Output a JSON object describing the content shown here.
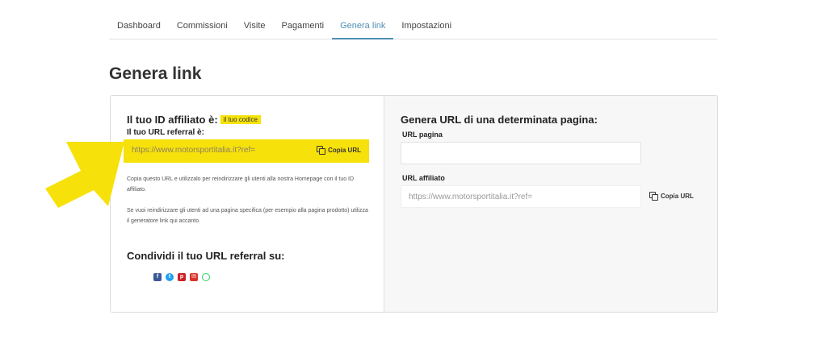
{
  "tabs": [
    {
      "label": "Dashboard"
    },
    {
      "label": "Commissioni"
    },
    {
      "label": "Visite"
    },
    {
      "label": "Pagamenti"
    },
    {
      "label": "Genera link",
      "active": true
    },
    {
      "label": "Impostazioni"
    }
  ],
  "page": {
    "title": "Genera link"
  },
  "left": {
    "id_title": "Il tuo ID affiliato è:",
    "id_code": "il tuo codice",
    "ref_label": "Il tuo URL referral è:",
    "ref_url": "https://www.motorsportitalia.it?ref=",
    "copy_label": "Copia URL",
    "help1": "Copia questo URL e utilizzalo per reindirizzare gli utenti alla nostra Homepage con il tuo ID affiliato.",
    "help2": "Se vuoi reindirizzare gli utenti ad una pagina specifica (per esempio alla pagina prodotto) utilizza il generatore link qui accanto.",
    "share_title": "Condividi il tuo URL referral su:",
    "social_icons": [
      "facebook-icon",
      "twitter-icon",
      "pinterest-icon",
      "mail-icon",
      "whatsapp-icon"
    ]
  },
  "right": {
    "title": "Genera URL di una determinata pagina:",
    "page_url_label": "URL pagina",
    "page_url_value": "",
    "affiliate_url_label": "URL affiliato",
    "affiliate_url_value": "https://www.motorsportitalia.it?ref=",
    "copy_label": "Copia URL"
  },
  "colors": {
    "accent": "#4f8fb3",
    "highlight": "#f7e10a",
    "arrow": "#f7e10a"
  }
}
